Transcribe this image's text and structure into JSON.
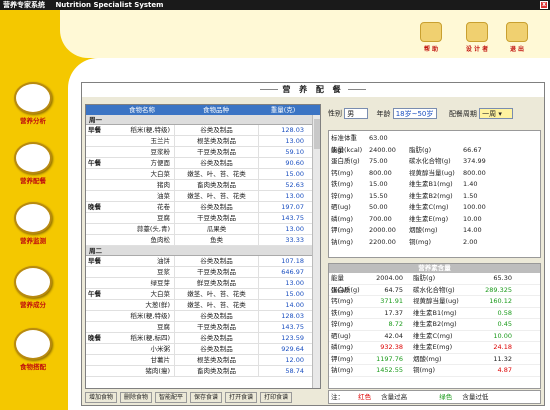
{
  "titlebar": {
    "app": "营养专家系统",
    "english": "Nutrition  Specialist  System",
    "close": "x"
  },
  "toolbar": [
    {
      "label": "帮 助",
      "icon": "question-icon"
    },
    {
      "label": "设 计 者",
      "icon": "designer-icon"
    },
    {
      "label": "退 出",
      "icon": "exit-icon"
    }
  ],
  "nav": [
    {
      "label": "营养分析",
      "icon": "chef-icon"
    },
    {
      "label": "营养配餐",
      "icon": "food-icon"
    },
    {
      "label": "营养监测",
      "icon": "heartbeat-icon"
    },
    {
      "label": "营养成分",
      "icon": "dish-icon"
    },
    {
      "label": "食物搭配",
      "icon": "meal-icon"
    }
  ],
  "window": {
    "title": "营 养 配 餐"
  },
  "left_table": {
    "headers": [
      "",
      "食物名称",
      "食物品种",
      "重量(克)"
    ],
    "weeks": [
      {
        "title": "周一",
        "rows": [
          {
            "meal": "早餐",
            "name": "稻米(粳,特级)",
            "type": "谷类及制品",
            "weight": "128.03"
          },
          {
            "meal": "",
            "name": "玉兰片",
            "type": "根茎类及制品",
            "weight": "13.00"
          },
          {
            "meal": "",
            "name": "豆浆粉",
            "type": "干豆类及制品",
            "weight": "59.10"
          },
          {
            "meal": "午餐",
            "name": "方便面",
            "type": "谷类及制品",
            "weight": "90.60"
          },
          {
            "meal": "",
            "name": "大白菜",
            "type": "嫩茎、叶、苔、花类",
            "weight": "15.00"
          },
          {
            "meal": "",
            "name": "猪肉",
            "type": "畜肉类及制品",
            "weight": "52.63"
          },
          {
            "meal": "",
            "name": "油菜",
            "type": "嫩茎、叶、苔、花类",
            "weight": "13.00"
          },
          {
            "meal": "晚餐",
            "name": "花卷",
            "type": "谷类及制品",
            "weight": "197.07"
          },
          {
            "meal": "",
            "name": "豆腐",
            "type": "干豆类及制品",
            "weight": "143.75"
          },
          {
            "meal": "",
            "name": "蒜薹(头,青)",
            "type": "瓜果类",
            "weight": "13.00"
          },
          {
            "meal": "",
            "name": "鱼肉松",
            "type": "鱼类",
            "weight": "33.33"
          }
        ]
      },
      {
        "title": "周二",
        "rows": [
          {
            "meal": "早餐",
            "name": "油饼",
            "type": "谷类及制品",
            "weight": "107.18"
          },
          {
            "meal": "",
            "name": "豆浆",
            "type": "干豆类及制品",
            "weight": "646.97"
          },
          {
            "meal": "",
            "name": "绿豆芽",
            "type": "鲜豆类及制品",
            "weight": "13.00"
          },
          {
            "meal": "午餐",
            "name": "大白菜",
            "type": "嫩茎、叶、苔、花类",
            "weight": "15.00"
          },
          {
            "meal": "",
            "name": "大葱(鲜)",
            "type": "嫩茎、叶、苔、花类",
            "weight": "14.00"
          },
          {
            "meal": "",
            "name": "稻米(粳,特级)",
            "type": "谷类及制品",
            "weight": "128.03"
          },
          {
            "meal": "",
            "name": "豆腐",
            "type": "干豆类及制品",
            "weight": "143.75"
          },
          {
            "meal": "晚餐",
            "name": "稻米(粳,标四)",
            "type": "谷类及制品",
            "weight": "123.59"
          },
          {
            "meal": "",
            "name": "小米粥",
            "type": "谷类及制品",
            "weight": "929.64"
          },
          {
            "meal": "",
            "name": "甘薯片",
            "type": "根茎类及制品",
            "weight": "12.00"
          },
          {
            "meal": "",
            "name": "猪肉(瘦)",
            "type": "畜肉类及制品",
            "weight": "58.74"
          }
        ]
      }
    ]
  },
  "left_buttons": [
    "增加食物",
    "删除食物",
    "智能配平",
    "保存食谱",
    "打开食谱",
    "打印食谱"
  ],
  "right_top": {
    "gender_label": "性别",
    "gender": "男",
    "age_label": "年龄",
    "age": "18岁~50岁",
    "period_label": "配餐周期",
    "period": "一周"
  },
  "standard": [
    {
      "l1": "标准体重(kg)",
      "v1": "63.00",
      "l2": "",
      "v2": ""
    },
    {
      "l1": "能量(kcal)",
      "v1": "2400.00",
      "l2": "脂肪(g)",
      "v2": "66.67"
    },
    {
      "l1": "蛋白质(g)",
      "v1": "75.00",
      "l2": "碳水化合物(g)",
      "v2": "374.99"
    },
    {
      "l1": "钙(mg)",
      "v1": "800.00",
      "l2": "视黄醇当量(ug)",
      "v2": "800.00"
    },
    {
      "l1": "铁(mg)",
      "v1": "15.00",
      "l2": "维生素B1(mg)",
      "v2": "1.40"
    },
    {
      "l1": "锌(mg)",
      "v1": "15.50",
      "l2": "维生素B2(mg)",
      "v2": "1.50"
    },
    {
      "l1": "硒(ug)",
      "v1": "50.00",
      "l2": "维生素C(mg)",
      "v2": "100.00"
    },
    {
      "l1": "磷(mg)",
      "v1": "700.00",
      "l2": "维生素E(mg)",
      "v2": "10.00"
    },
    {
      "l1": "钾(mg)",
      "v1": "2000.00",
      "l2": "烟酸(mg)",
      "v2": "14.00"
    },
    {
      "l1": "钠(mg)",
      "v1": "2200.00",
      "l2": "铜(mg)",
      "v2": "2.00"
    }
  ],
  "nutrient": {
    "title": "营养素含量",
    "rows": [
      {
        "l1": "能量(kcal)",
        "v1": "2004.00",
        "c1": "#222222",
        "l2": "脂肪(g)",
        "v2": "65.30",
        "c2": "#222222"
      },
      {
        "l1": "蛋白质(g)",
        "v1": "64.75",
        "c1": "#222222",
        "l2": "碳水化合物(g)",
        "v2": "289.325",
        "c2": "#1a9a1a"
      },
      {
        "l1": "钙(mg)",
        "v1": "371.91",
        "c1": "#1a9a1a",
        "l2": "视黄醇当量(ug)",
        "v2": "160.12",
        "c2": "#1a9a1a"
      },
      {
        "l1": "铁(mg)",
        "v1": "17.37",
        "c1": "#222222",
        "l2": "维生素B1(mg)",
        "v2": "0.58",
        "c2": "#1a9a1a"
      },
      {
        "l1": "锌(mg)",
        "v1": "8.72",
        "c1": "#1a9a1a",
        "l2": "维生素B2(mg)",
        "v2": "0.45",
        "c2": "#1a9a1a"
      },
      {
        "l1": "硒(ug)",
        "v1": "42.04",
        "c1": "#222222",
        "l2": "维生素C(mg)",
        "v2": "10.00",
        "c2": "#1a9a1a"
      },
      {
        "l1": "磷(mg)",
        "v1": "932.38",
        "c1": "#dd0000",
        "l2": "维生素E(mg)",
        "v2": "24.18",
        "c2": "#dd0000"
      },
      {
        "l1": "钾(mg)",
        "v1": "1197.76",
        "c1": "#1a9a1a",
        "l2": "烟酸(mg)",
        "v2": "11.32",
        "c2": "#222222"
      },
      {
        "l1": "钠(mg)",
        "v1": "1452.55",
        "c1": "#1a9a1a",
        "l2": "铜(mg)",
        "v2": "4.87",
        "c2": "#dd0000"
      }
    ]
  },
  "note": {
    "prefix": "注：",
    "red_label": "红色",
    "red_text": "含量过高",
    "green_label": "绿色",
    "green_text": "含量过低"
  }
}
